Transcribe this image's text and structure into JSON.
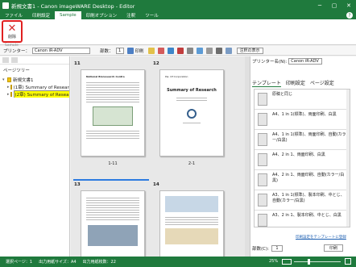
{
  "window": {
    "title": "新規文書1 - Canon imageWARE Desktop - Editor",
    "min": "─",
    "max": "▢",
    "close": "✕"
  },
  "menu": {
    "tabs": [
      "ファイル",
      "印刷設定",
      "Sample",
      "印刷オプション",
      "注釈",
      "ツール"
    ],
    "active_index": 2,
    "help": "?"
  },
  "ribbon": {
    "delete_label": "削除",
    "group_label": "Sample"
  },
  "toolbar": {
    "printer_label": "プリンター：",
    "printer_value": "Canon iR-ADV",
    "copies_label": "部数：",
    "copies_value": "1",
    "print_label": "印刷",
    "annot_label": "注釈の表示"
  },
  "left_pane": {
    "title": "ページツリー",
    "root": "新規文書1",
    "items": [
      {
        "label": "(1章) Summary of Research",
        "selected": false
      },
      {
        "label": "(2章) Summary of Research",
        "selected": true
      }
    ]
  },
  "thumbnails": [
    {
      "num": "11",
      "caption": "1-11",
      "title": "",
      "heading": "National Bioresearch Centre"
    },
    {
      "num": "12",
      "caption": "2-1",
      "title": "Summary of Research",
      "heading": "Pei. Of Corporation"
    },
    {
      "num": "13",
      "caption": "",
      "title": "",
      "heading": ""
    },
    {
      "num": "14",
      "caption": "",
      "title": "",
      "heading": ""
    }
  ],
  "right_pane": {
    "printer_label": "プリンター名(N):",
    "printer_value": "Canon iR-ADV",
    "tabs": [
      "テンプレート",
      "印刷設定",
      "ページ設定"
    ],
    "active_tab": 0,
    "templates": [
      "原稿と同じ",
      "A4、1 in 1(標準)、両面印刷、白黒",
      "A4、1 in 1(標準)、両面印刷、自動(カラー/白黒)",
      "A4、2 in 1、両面印刷、白黒",
      "A4、2 in 1、両面印刷、自動(カラー/白黒)",
      "A3、1 in 1(標準)、製本印刷、中とじ、自動(カラー/白黒)",
      "A3、2 in 1、製本印刷、中とじ、白黒"
    ],
    "link": "印刷設定をテンプレートに登録",
    "copies_label": "部数(C):",
    "copies_value": "1",
    "print_label": "印刷"
  },
  "status": {
    "selected_page": "選択ページ：1",
    "output_size": "出力用紙サイズ：A4",
    "output_count": "出力用紙枚数：22",
    "zoom": "25%"
  }
}
